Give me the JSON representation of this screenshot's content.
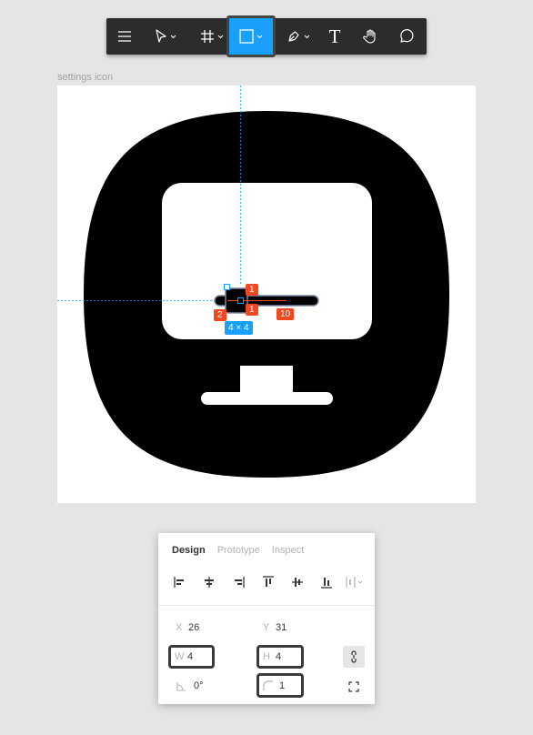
{
  "toolbar": {
    "tools": [
      {
        "name": "menu",
        "icon": "hamburger-menu-icon"
      },
      {
        "name": "move",
        "icon": "move-arrow-icon"
      },
      {
        "name": "frame",
        "icon": "frame-hash-icon"
      },
      {
        "name": "rectangle",
        "icon": "rectangle-icon",
        "active": true
      },
      {
        "name": "pen",
        "icon": "pen-icon"
      },
      {
        "name": "text",
        "icon": "text-icon",
        "glyph": "T"
      },
      {
        "name": "hand",
        "icon": "hand-icon"
      },
      {
        "name": "comment",
        "icon": "comment-icon"
      }
    ],
    "active_color": "#18a0fb",
    "bg_color": "#2c2c2c"
  },
  "canvas": {
    "frame_label": "settings icon",
    "measurements": {
      "top": "1",
      "bottom": "1",
      "left": "2",
      "right": "10"
    },
    "selection_size": "4 × 4",
    "measure_color": "#f24822",
    "selection_color": "#18a0fb"
  },
  "panel": {
    "tabs": [
      {
        "label": "Design",
        "active": true
      },
      {
        "label": "Prototype",
        "active": false
      },
      {
        "label": "Inspect",
        "active": false
      }
    ],
    "x": {
      "label": "X",
      "value": "26"
    },
    "y": {
      "label": "Y",
      "value": "31"
    },
    "w": {
      "label": "W",
      "value": "4"
    },
    "h": {
      "label": "H",
      "value": "4"
    },
    "rotation": {
      "value": "0°"
    },
    "radius": {
      "value": "1"
    }
  }
}
